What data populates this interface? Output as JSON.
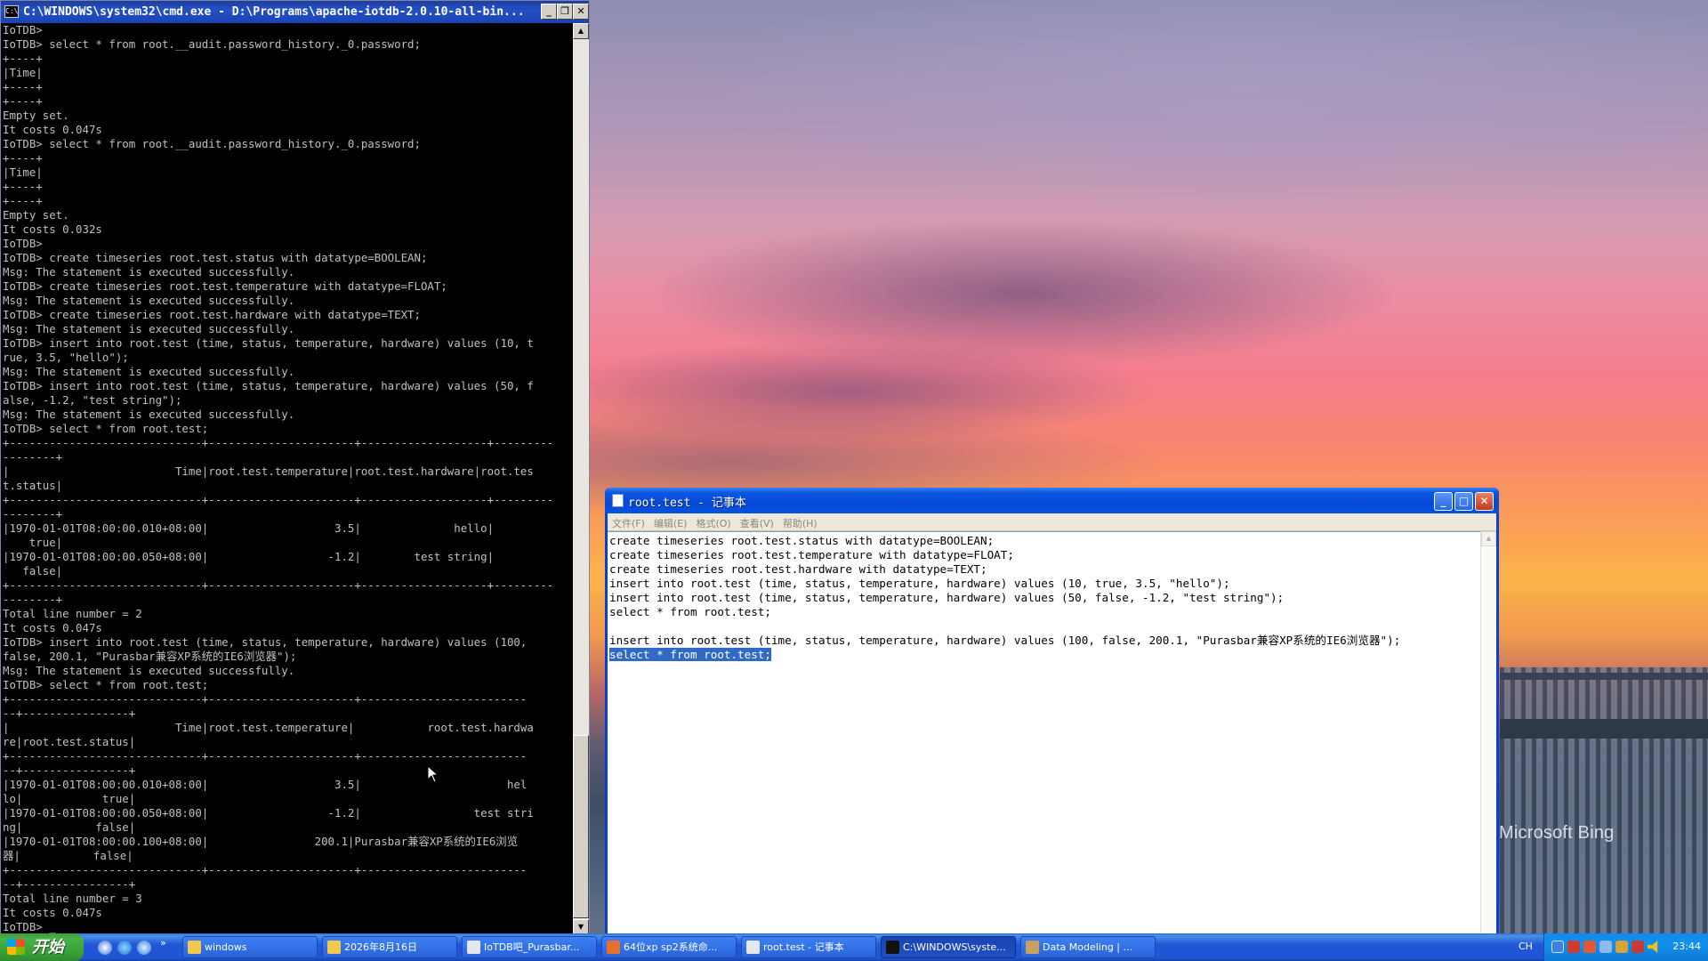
{
  "desktop": {
    "watermark": "Microsoft Bing"
  },
  "cmd": {
    "title": "C:\\WINDOWS\\system32\\cmd.exe - D:\\Programs\\apache-iotdb-2.0.10-all-bin...",
    "lines": [
      "IoTDB>",
      "IoTDB> select * from root.__audit.password_history._0.password;",
      "+----+",
      "|Time|",
      "+----+",
      "+----+",
      "Empty set.",
      "It costs 0.047s",
      "IoTDB> select * from root.__audit.password_history._0.password;",
      "+----+",
      "|Time|",
      "+----+",
      "+----+",
      "Empty set.",
      "It costs 0.032s",
      "IoTDB>",
      "IoTDB> create timeseries root.test.status with datatype=BOOLEAN;",
      "Msg: The statement is executed successfully.",
      "IoTDB> create timeseries root.test.temperature with datatype=FLOAT;",
      "Msg: The statement is executed successfully.",
      "IoTDB> create timeseries root.test.hardware with datatype=TEXT;",
      "Msg: The statement is executed successfully.",
      "IoTDB> insert into root.test (time, status, temperature, hardware) values (10, t",
      "rue, 3.5, \"hello\");",
      "Msg: The statement is executed successfully.",
      "IoTDB> insert into root.test (time, status, temperature, hardware) values (50, f",
      "alse, -1.2, \"test string\");",
      "Msg: The statement is executed successfully.",
      "IoTDB> select * from root.test;",
      "+-----------------------------+----------------------+-------------------+---------",
      "--------+",
      "|                         Time|root.test.temperature|root.test.hardware|root.tes",
      "t.status|",
      "+-----------------------------+----------------------+-------------------+---------",
      "--------+",
      "|1970-01-01T08:00:00.010+08:00|                   3.5|              hello|",
      "    true|",
      "|1970-01-01T08:00:00.050+08:00|                  -1.2|        test string|",
      "   false|",
      "+-----------------------------+----------------------+-------------------+---------",
      "--------+",
      "Total line number = 2",
      "It costs 0.047s",
      "IoTDB> insert into root.test (time, status, temperature, hardware) values (100,",
      "false, 200.1, \"Purasbar兼容XP系统的IE6浏览器\");",
      "Msg: The statement is executed successfully.",
      "IoTDB> select * from root.test;",
      "+-----------------------------+----------------------+-------------------------",
      "--+----------------+",
      "|                         Time|root.test.temperature|           root.test.hardwa",
      "re|root.test.status|",
      "+-----------------------------+----------------------+-------------------------",
      "--+----------------+",
      "|1970-01-01T08:00:00.010+08:00|                   3.5|                      hel",
      "lo|            true|",
      "|1970-01-01T08:00:00.050+08:00|                  -1.2|                 test stri",
      "ng|           false|",
      "|1970-01-01T08:00:00.100+08:00|                200.1|Purasbar兼容XP系统的IE6浏览",
      "器|           false|",
      "+-----------------------------+----------------------+-------------------------",
      "--+----------------+",
      "Total line number = 3",
      "It costs 0.047s",
      "IoTDB> _"
    ]
  },
  "notepad": {
    "title": "root.test - 记事本",
    "menu": [
      "文件(F)",
      "编辑(E)",
      "格式(O)",
      "查看(V)",
      "帮助(H)"
    ],
    "lines": [
      "create timeseries root.test.status with datatype=BOOLEAN;",
      "create timeseries root.test.temperature with datatype=FLOAT;",
      "create timeseries root.test.hardware with datatype=TEXT;",
      "insert into root.test (time, status, temperature, hardware) values (10, true, 3.5, \"hello\");",
      "insert into root.test (time, status, temperature, hardware) values (50, false, -1.2, \"test string\");",
      "select * from root.test;",
      "",
      "insert into root.test (time, status, temperature, hardware) values (100, false, 200.1, \"Purasbar兼容XP系统的IE6浏览器\");"
    ],
    "selected_line": "select * from root.test;"
  },
  "taskbar": {
    "start_label": "开始",
    "buttons": [
      {
        "label": "windows",
        "active": false,
        "color": "#f2c94c"
      },
      {
        "label": "2026年8月16日",
        "active": false,
        "color": "#f2c94c"
      },
      {
        "label": "IoTDB吧_Purasbar...",
        "active": false,
        "color": "#e6e6f0"
      },
      {
        "label": "64位xp sp2系统命...",
        "active": false,
        "color": "#e8702a"
      },
      {
        "label": "root.test - 记事本",
        "active": false,
        "color": "#e6e6f0"
      },
      {
        "label": "C:\\WINDOWS\\syste...",
        "active": true,
        "color": "#111111"
      },
      {
        "label": "Data Modeling | ...",
        "active": false,
        "color": "#c8a060"
      }
    ],
    "ime": "CH",
    "clock": "23:44"
  }
}
